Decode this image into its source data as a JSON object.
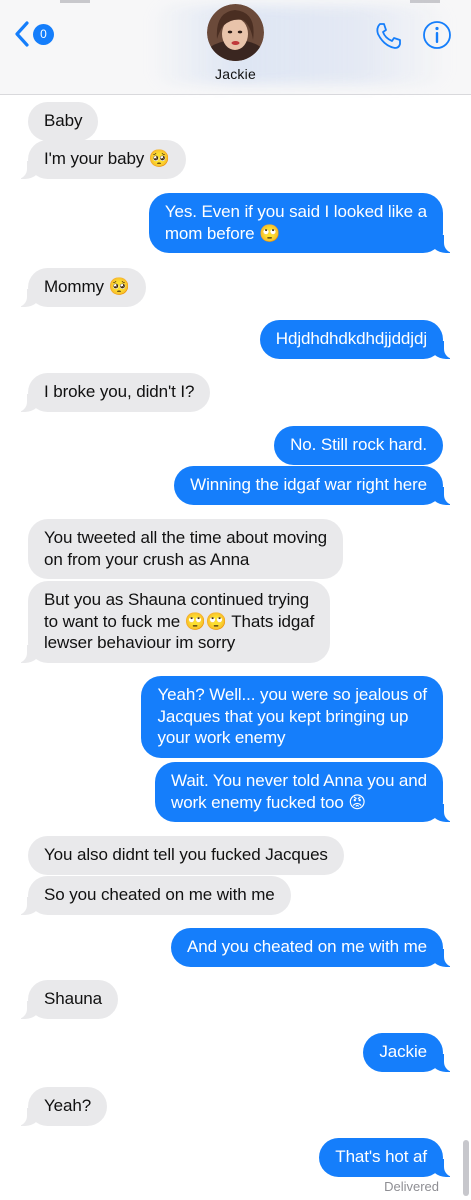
{
  "header": {
    "back_badge_count": "0",
    "contact_name": "Jackie",
    "accent_color": "#157efb"
  },
  "messages": [
    {
      "from": "them",
      "text": "Baby"
    },
    {
      "from": "them",
      "text": "I'm your baby 🥺"
    },
    {
      "from": "me",
      "text": "Yes. Even if you said I looked like a\nmom before 🙄"
    },
    {
      "from": "them",
      "text": "Mommy 🥺"
    },
    {
      "from": "me",
      "text": "Hdjdhdhdkdhdjjddjdj"
    },
    {
      "from": "them",
      "text": "I broke you, didn't I?"
    },
    {
      "from": "me",
      "text": "No. Still rock hard."
    },
    {
      "from": "me",
      "text": "Winning the idgaf war right here"
    },
    {
      "from": "them",
      "text": "You tweeted all the time about moving\non from your crush as Anna"
    },
    {
      "from": "them",
      "text": "But you as Shauna continued trying\nto want to fuck me 🙄🙄 Thats idgaf\nlewser behaviour im sorry"
    },
    {
      "from": "me",
      "text": "Yeah? Well... you were so jealous of\nJacques that you kept bringing up\nyour work enemy"
    },
    {
      "from": "me",
      "text": "Wait. You never told Anna you and\nwork enemy fucked too 😡"
    },
    {
      "from": "them",
      "text": "You also didnt tell you fucked Jacques"
    },
    {
      "from": "them",
      "text": "So you cheated on me with me"
    },
    {
      "from": "me",
      "text": "And you cheated on me with me"
    },
    {
      "from": "them",
      "text": "Shauna"
    },
    {
      "from": "me",
      "text": "Jackie"
    },
    {
      "from": "them",
      "text": "Yeah?"
    },
    {
      "from": "me",
      "text": "That's hot af"
    }
  ],
  "status": {
    "delivered": "Delivered"
  },
  "colors": {
    "incoming_bubble": "#e9e9eb",
    "outgoing_bubble": "#157efb",
    "header_bg": "#f7f7f8"
  },
  "icons": [
    "back-chevron-icon",
    "phone-icon",
    "info-icon"
  ]
}
